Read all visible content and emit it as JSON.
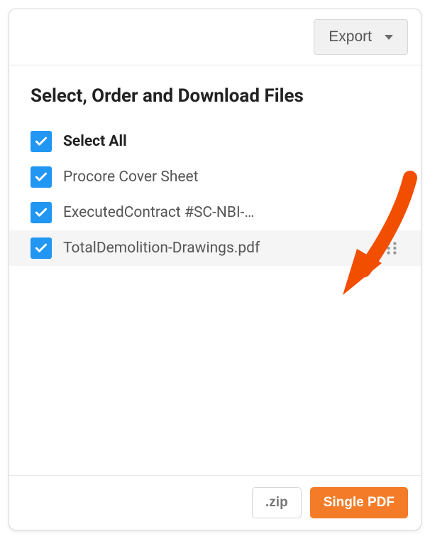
{
  "header": {
    "export_label": "Export"
  },
  "main": {
    "title": "Select, Order and Download Files",
    "select_all_label": "Select All",
    "files": [
      {
        "label": "Procore Cover Sheet",
        "checked": true
      },
      {
        "label": "ExecutedContract #SC-NBI-…",
        "checked": true
      },
      {
        "label": "TotalDemolition-Drawings.pdf",
        "checked": true
      }
    ]
  },
  "footer": {
    "zip_label": ".zip",
    "pdf_label": "Single PDF"
  },
  "colors": {
    "accent": "#f47b27",
    "checkbox": "#2196f3",
    "annotation": "#f24e00"
  }
}
